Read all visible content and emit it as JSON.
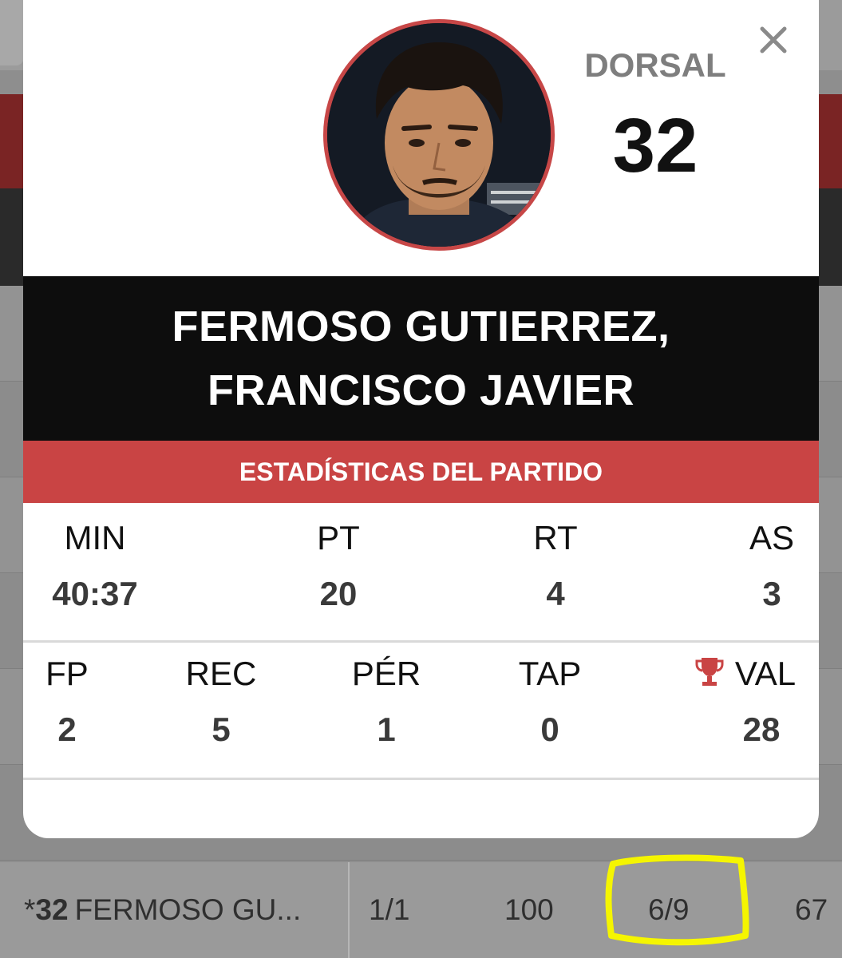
{
  "background": {
    "last_row": {
      "prefix": "*",
      "number": "32",
      "name": "FERMOSO GU...",
      "cells": [
        "1/1",
        "100",
        "6/9",
        "67"
      ]
    }
  },
  "modal": {
    "dorsal_label": "DORSAL",
    "dorsal_number": "32",
    "player_name_line1": "FERMOSO GUTIERREZ,",
    "player_name_line2": "FRANCISCO JAVIER",
    "stats_title": "ESTADÍSTICAS DEL PARTIDO",
    "stats_row1": [
      {
        "label": "MIN",
        "value": "40:37"
      },
      {
        "label": "PT",
        "value": "20"
      },
      {
        "label": "RT",
        "value": "4"
      },
      {
        "label": "AS",
        "value": "3"
      }
    ],
    "stats_row2": [
      {
        "label": "FP",
        "value": "2"
      },
      {
        "label": "REC",
        "value": "5"
      },
      {
        "label": "PÉR",
        "value": "1"
      },
      {
        "label": "TAP",
        "value": "0"
      },
      {
        "label": "VAL",
        "value": "28"
      }
    ]
  },
  "colors": {
    "accent_red": "#c94444",
    "name_band": "#0d0d0d",
    "highlight_yellow": "#f5f500"
  },
  "icons": [
    "close-icon",
    "trophy-icon"
  ]
}
